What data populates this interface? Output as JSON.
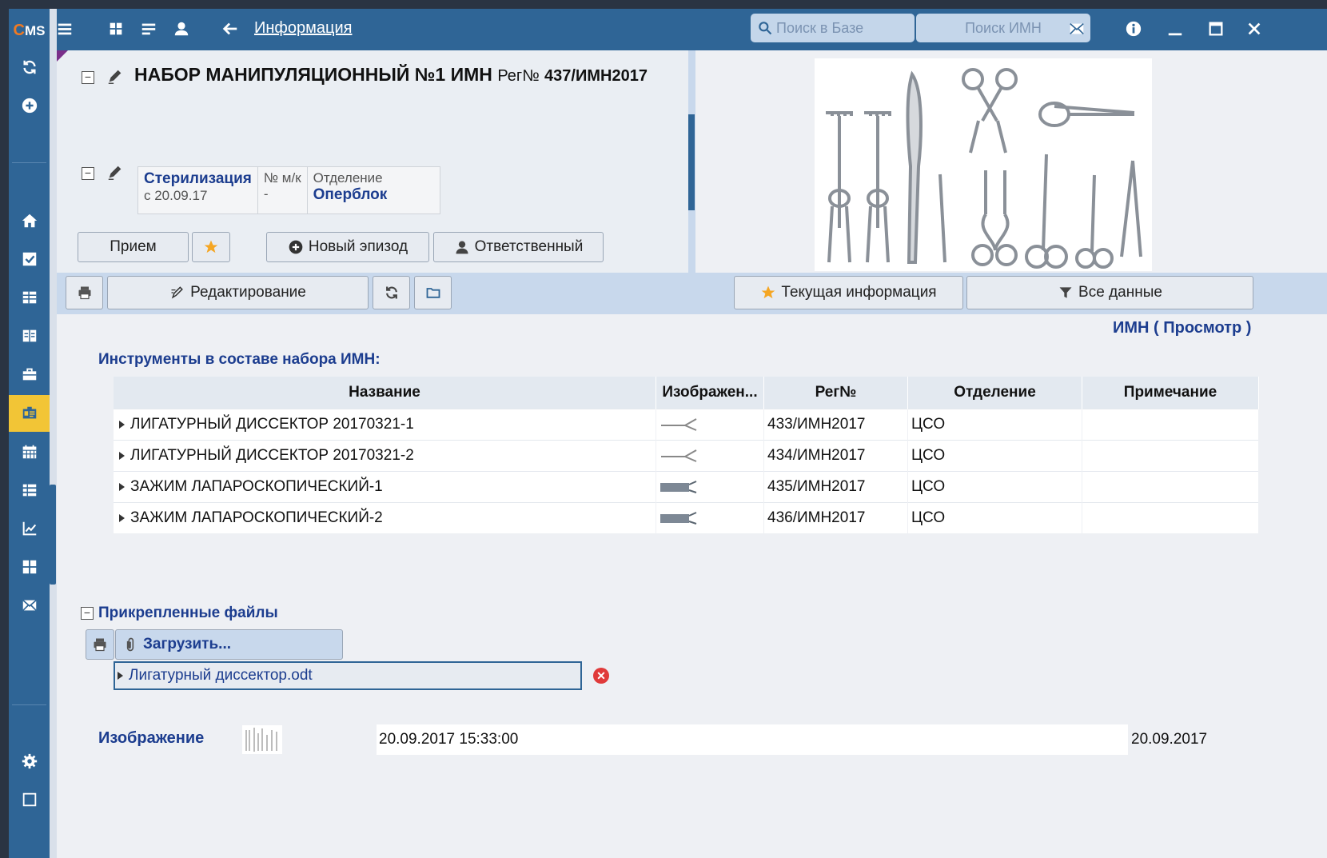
{
  "app": {
    "logo_c": "C",
    "logo_ms": "MS"
  },
  "topbar": {
    "link": "Информация",
    "search_db": "Поиск в Базе",
    "search_imn": "Поиск ИМН",
    "icons": [
      "menu-icon",
      "grid-icon",
      "list-icon",
      "user-icon",
      "back-arrow-icon",
      "mail-icon",
      "info-icon",
      "minimize-icon",
      "maximize-icon",
      "close-icon"
    ]
  },
  "sidebar": {
    "icons": [
      "refresh-icon",
      "add-circle-icon",
      "home-icon",
      "check-square-icon",
      "table-icon",
      "book-icon",
      "briefcase-icon",
      "id-card-icon",
      "calendar-icon",
      "list-lines-icon",
      "chart-icon",
      "grid-icon",
      "mail-icon",
      "settings-icon",
      "square-icon"
    ],
    "active": "id-card-icon"
  },
  "header": {
    "title": "НАБОР МАНИПУЛЯЦИОННЫЙ №1 ИМН",
    "reg_label": "Рег№",
    "reg_no": "437/ИМН2017",
    "status_title": "Стерилизация",
    "status_date": "с 20.09.17",
    "mk_label": "№ м/к",
    "mk_value": "-",
    "dept_label": "Отделение",
    "dept_value": "Оперблок",
    "btn_priem": "Прием",
    "btn_new_episode": "Новый эпизод",
    "btn_responsible": "Ответственный"
  },
  "toolbar": {
    "edit": "Редактирование",
    "current_info": "Текущая информация",
    "all_data": "Все данные"
  },
  "mode": "ИМН ( Просмотр )",
  "instruments": {
    "section_title": "Инструменты в составе набора ИМН:",
    "columns": [
      "Название",
      "Изображен...",
      "Рег№",
      "Отделение",
      "Примечание"
    ],
    "rows": [
      {
        "name": "ЛИГАТУРНЫЙ ДИССЕКТОР 20170321-1",
        "reg": "433/ИМН2017",
        "dept": "ЦСО",
        "note": "",
        "thumb": "dissector"
      },
      {
        "name": "ЛИГАТУРНЫЙ ДИССЕКТОР 20170321-2",
        "reg": "434/ИМН2017",
        "dept": "ЦСО",
        "note": "",
        "thumb": "dissector"
      },
      {
        "name": "ЗАЖИМ ЛАПАРОСКОПИЧЕСКИЙ-1",
        "reg": "435/ИМН2017",
        "dept": "ЦСО",
        "note": "",
        "thumb": "clamp"
      },
      {
        "name": "ЗАЖИМ ЛАПАРОСКОПИЧЕСКИЙ-2",
        "reg": "436/ИМН2017",
        "dept": "ЦСО",
        "note": "",
        "thumb": "clamp"
      }
    ]
  },
  "files": {
    "section_title": "Прикрепленные файлы",
    "upload": "Загрузить...",
    "items": [
      "Лигатурный диссектор.odt"
    ]
  },
  "image_row": {
    "label": "Изображение",
    "datetime": "20.09.2017 15:33:00",
    "date": "20.09.2017"
  },
  "colors": {
    "primary": "#2f6596",
    "accent": "#f2c536",
    "link_text": "#1c3d8f",
    "delete": "#e03a3a"
  }
}
